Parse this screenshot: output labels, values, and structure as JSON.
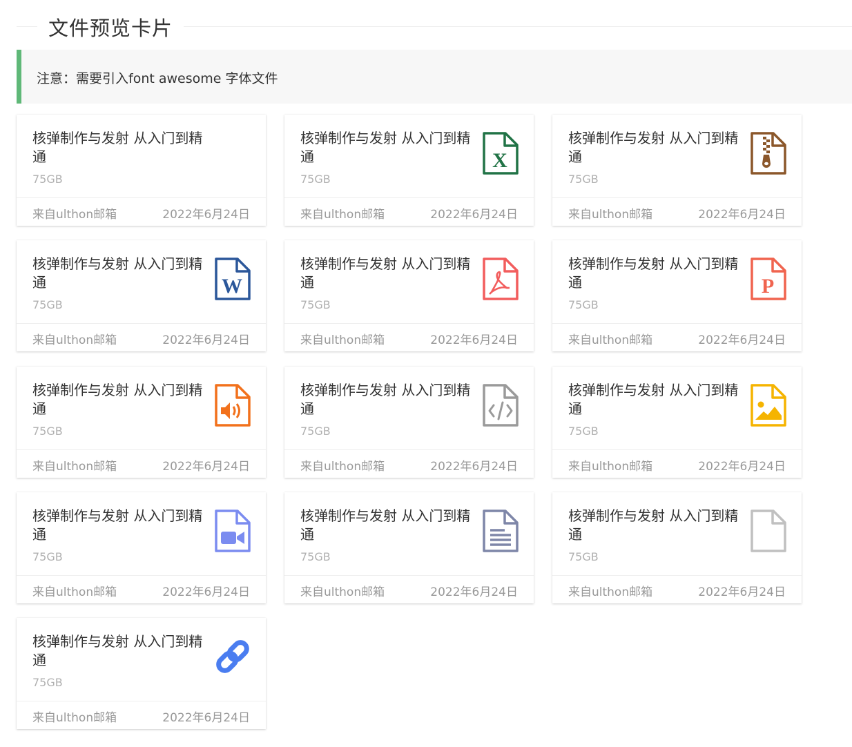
{
  "header": {
    "title": "文件预览卡片"
  },
  "notice": {
    "text": "注意：需要引入font awesome 字体文件",
    "accent_color": "#5fb878"
  },
  "cards": [
    {
      "name": "核弹制作与发射 从入门到精通",
      "size": "75GB",
      "source": "来自ulthon邮箱",
      "date": "2022年6月24日",
      "icon": "none",
      "color": ""
    },
    {
      "name": "核弹制作与发射 从入门到精通",
      "size": "75GB",
      "source": "来自ulthon邮箱",
      "date": "2022年6月24日",
      "icon": "file-excel-icon",
      "color": "#217346"
    },
    {
      "name": "核弹制作与发射 从入门到精通",
      "size": "75GB",
      "source": "来自ulthon邮箱",
      "date": "2022年6月24日",
      "icon": "file-archive-icon",
      "color": "#8b572a"
    },
    {
      "name": "核弹制作与发射 从入门到精通",
      "size": "75GB",
      "source": "来自ulthon邮箱",
      "date": "2022年6月24日",
      "icon": "file-word-icon",
      "color": "#2b579a"
    },
    {
      "name": "核弹制作与发射 从入门到精通",
      "size": "75GB",
      "source": "来自ulthon邮箱",
      "date": "2022年6月24日",
      "icon": "file-pdf-icon",
      "color": "#f25d5d"
    },
    {
      "name": "核弹制作与发射 从入门到精通",
      "size": "75GB",
      "source": "来自ulthon邮箱",
      "date": "2022年6月24日",
      "icon": "file-powerpoint-icon",
      "color": "#f0644f"
    },
    {
      "name": "核弹制作与发射 从入门到精通",
      "size": "75GB",
      "source": "来自ulthon邮箱",
      "date": "2022年6月24日",
      "icon": "file-audio-icon",
      "color": "#f2711c"
    },
    {
      "name": "核弹制作与发射 从入门到精通",
      "size": "75GB",
      "source": "来自ulthon邮箱",
      "date": "2022年6月24日",
      "icon": "file-code-icon",
      "color": "#9a9a9a"
    },
    {
      "name": "核弹制作与发射 从入门到精通",
      "size": "75GB",
      "source": "来自ulthon邮箱",
      "date": "2022年6月24日",
      "icon": "file-image-icon",
      "color": "#f5b400"
    },
    {
      "name": "核弹制作与发射 从入门到精通",
      "size": "75GB",
      "source": "来自ulthon邮箱",
      "date": "2022年6月24日",
      "icon": "file-video-icon",
      "color": "#7b8cf0"
    },
    {
      "name": "核弹制作与发射 从入门到精通",
      "size": "75GB",
      "source": "来自ulthon邮箱",
      "date": "2022年6月24日",
      "icon": "file-text-icon",
      "color": "#7e86a8"
    },
    {
      "name": "核弹制作与发射 从入门到精通",
      "size": "75GB",
      "source": "来自ulthon邮箱",
      "date": "2022年6月24日",
      "icon": "file-blank-icon",
      "color": "#c0c0c0"
    },
    {
      "name": "核弹制作与发射 从入门到精通",
      "size": "75GB",
      "source": "来自ulthon邮箱",
      "date": "2022年6月24日",
      "icon": "link-icon",
      "color": "#4a7df0"
    }
  ]
}
